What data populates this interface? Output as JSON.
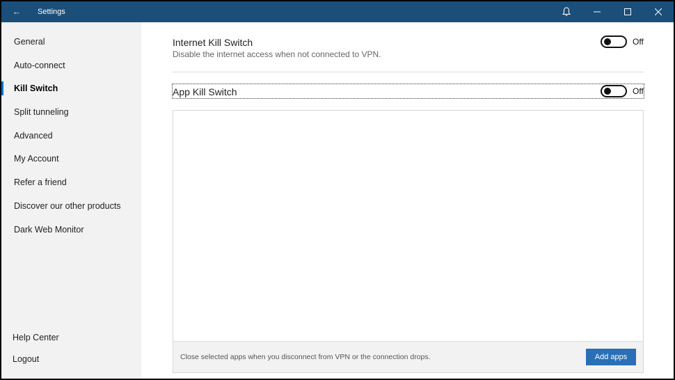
{
  "window": {
    "title": "Settings",
    "back_icon": "back-arrow-icon",
    "controls": [
      "bell-icon",
      "minimize-icon",
      "maximize-icon",
      "close-icon"
    ],
    "titlebar_color": "#1b4f7a"
  },
  "sidebar": {
    "items": [
      {
        "label": "General",
        "active": false
      },
      {
        "label": "Auto-connect",
        "active": false
      },
      {
        "label": "Kill Switch",
        "active": true
      },
      {
        "label": "Split tunneling",
        "active": false
      },
      {
        "label": "Advanced",
        "active": false
      },
      {
        "label": "My Account",
        "active": false
      },
      {
        "label": "Refer a friend",
        "active": false
      },
      {
        "label": "Discover our other products",
        "active": false
      },
      {
        "label": "Dark Web Monitor",
        "active": false
      }
    ],
    "footer": [
      {
        "label": "Help Center"
      },
      {
        "label": "Logout"
      }
    ],
    "accent": "#0b6fd6"
  },
  "main": {
    "internet_kill_switch": {
      "title": "Internet Kill Switch",
      "description": "Disable the internet access when not connected to VPN.",
      "toggle_state": "Off"
    },
    "app_kill_switch": {
      "title": "App Kill Switch",
      "toggle_state": "Off",
      "footer_hint": "Close selected apps when you disconnect from VPN or the connection drops.",
      "add_button": "Add apps",
      "button_color": "#2a6fb6"
    }
  }
}
